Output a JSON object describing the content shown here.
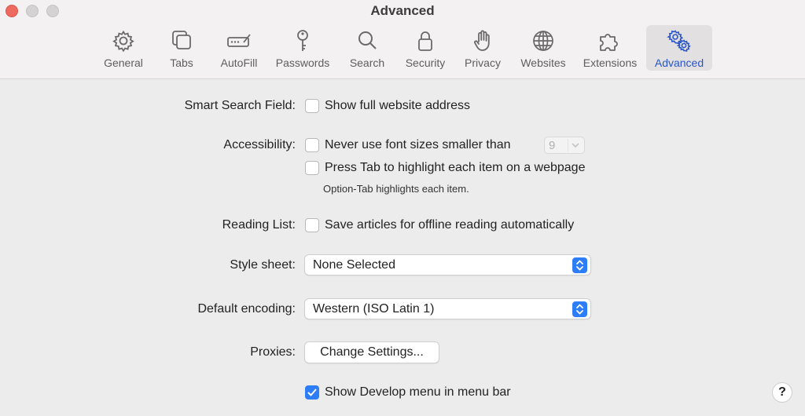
{
  "window": {
    "title": "Advanced"
  },
  "toolbar": {
    "items": [
      {
        "label": "General",
        "icon": "gear-icon"
      },
      {
        "label": "Tabs",
        "icon": "tabs-icon"
      },
      {
        "label": "AutoFill",
        "icon": "autofill-icon"
      },
      {
        "label": "Passwords",
        "icon": "key-icon"
      },
      {
        "label": "Search",
        "icon": "search-icon"
      },
      {
        "label": "Security",
        "icon": "lock-icon"
      },
      {
        "label": "Privacy",
        "icon": "hand-icon"
      },
      {
        "label": "Websites",
        "icon": "globe-icon"
      },
      {
        "label": "Extensions",
        "icon": "puzzle-icon"
      },
      {
        "label": "Advanced",
        "icon": "gears-icon"
      }
    ],
    "selected": "Advanced",
    "accent": "#2a55c8"
  },
  "settings": {
    "smart_search": {
      "label": "Smart Search Field:",
      "option": "Show full website address",
      "checked": false
    },
    "accessibility": {
      "label": "Accessibility:",
      "font_option": "Never use font sizes smaller than",
      "font_option_checked": false,
      "font_size_value": "9",
      "tab_option": "Press Tab to highlight each item on a webpage",
      "tab_option_checked": false,
      "hint": "Option-Tab highlights each item."
    },
    "reading_list": {
      "label": "Reading List:",
      "option": "Save articles for offline reading automatically",
      "checked": false
    },
    "style_sheet": {
      "label": "Style sheet:",
      "value": "None Selected"
    },
    "default_encoding": {
      "label": "Default encoding:",
      "value": "Western (ISO Latin 1)"
    },
    "proxies": {
      "label": "Proxies:",
      "button": "Change Settings..."
    },
    "develop_menu": {
      "option": "Show Develop menu in menu bar",
      "checked": true
    }
  },
  "help": {
    "label": "?"
  },
  "colors": {
    "accent_blue": "#2d7df6",
    "close_red": "#ee6a5f"
  }
}
